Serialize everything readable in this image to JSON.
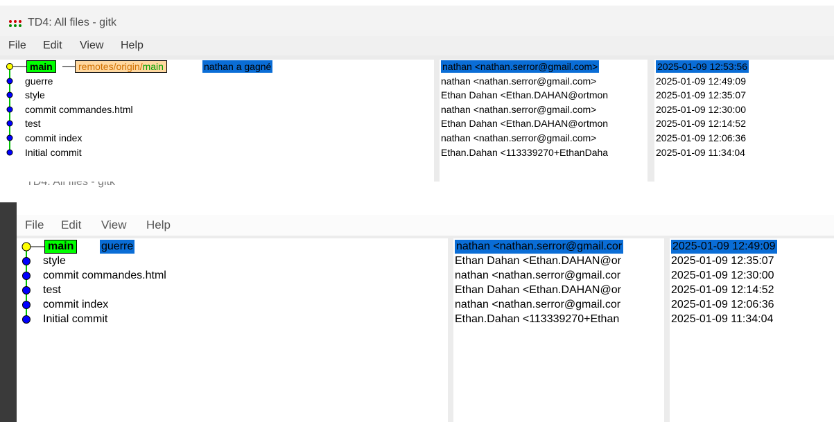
{
  "window1": {
    "title": "TD4: All files - gitk",
    "menu": [
      "File",
      "Edit",
      "View",
      "Help"
    ],
    "head_ref": "main",
    "remote_ref": {
      "prefix": "remotes/origin/",
      "branch": "main"
    },
    "commits": [
      {
        "message": "nathan a gagné",
        "author": "nathan <nathan.serror@gmail.com>",
        "date": "2025-01-09 12:53:56"
      },
      {
        "message": "guerre",
        "author": "nathan <nathan.serror@gmail.com>",
        "date": "2025-01-09 12:49:09"
      },
      {
        "message": "style",
        "author": "Ethan Dahan <Ethan.DAHAN@ortmon",
        "date": "2025-01-09 12:35:07"
      },
      {
        "message": "commit commandes.html",
        "author": "nathan <nathan.serror@gmail.com>",
        "date": "2025-01-09 12:30:00"
      },
      {
        "message": "test",
        "author": "Ethan Dahan <Ethan.DAHAN@ortmon",
        "date": "2025-01-09 12:14:52"
      },
      {
        "message": "commit index",
        "author": "nathan <nathan.serror@gmail.com>",
        "date": "2025-01-09 12:06:36"
      },
      {
        "message": "Initial commit",
        "author": "Ethan.Dahan <113339270+EthanDaha",
        "date": "2025-01-09 11:34:04"
      }
    ]
  },
  "window2": {
    "title_partial": "TD4: All files - gitk",
    "menu": [
      "File",
      "Edit",
      "View",
      "Help"
    ],
    "head_ref": "main",
    "commits": [
      {
        "message": "guerre",
        "author": "nathan <nathan.serror@gmail.cor",
        "date": "2025-01-09 12:49:09"
      },
      {
        "message": "style",
        "author": "Ethan Dahan <Ethan.DAHAN@or",
        "date": "2025-01-09 12:35:07"
      },
      {
        "message": "commit commandes.html",
        "author": "nathan <nathan.serror@gmail.cor",
        "date": "2025-01-09 12:30:00"
      },
      {
        "message": "test",
        "author": "Ethan Dahan <Ethan.DAHAN@or",
        "date": "2025-01-09 12:14:52"
      },
      {
        "message": "commit index",
        "author": "nathan <nathan.serror@gmail.cor",
        "date": "2025-01-09 12:06:36"
      },
      {
        "message": "Initial commit",
        "author": "Ethan.Dahan <113339270+Ethan",
        "date": "2025-01-09 11:34:04"
      }
    ]
  },
  "colors": {
    "selection": "#0a6dd6",
    "branch_tag": "#00ff00",
    "remote_tag": "#ffd8a0",
    "commit_dot": "#0000ff",
    "head_dot": "#ffff00",
    "graph_line": "#00c000"
  }
}
